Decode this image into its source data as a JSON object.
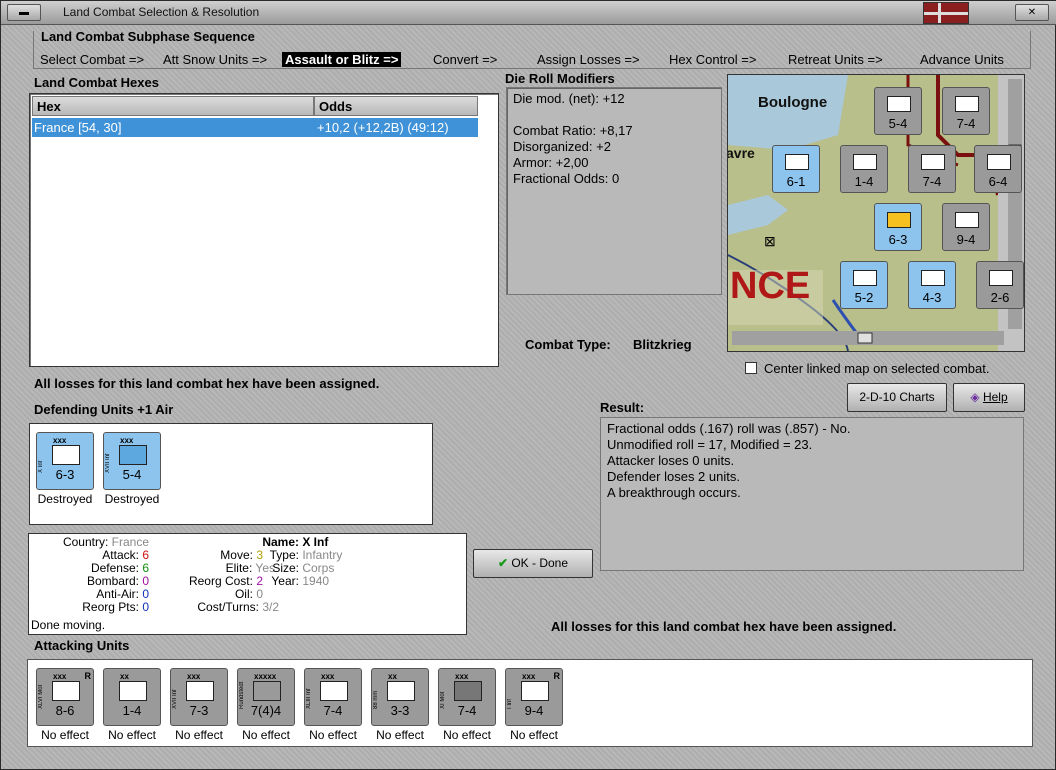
{
  "window": {
    "title": "Land Combat Selection & Resolution"
  },
  "phase": {
    "title": "Land Combat Subphase Sequence",
    "steps": [
      "Select Combat =>",
      "Att Snow Units =>",
      "Assault or Blitz =>",
      "Convert =>",
      "Assign Losses =>",
      "Hex Control =>",
      "Retreat Units =>",
      "Advance Units"
    ],
    "active_index": 2
  },
  "hexes": {
    "label": "Land Combat Hexes",
    "columns": [
      "Hex",
      "Odds"
    ],
    "rows": [
      {
        "hex": "France [54, 30]",
        "odds": "+10,2 (+12,2B) (49:12)"
      }
    ]
  },
  "drm": {
    "label": "Die Roll Modifiers",
    "lines": [
      "Die mod. (net): +12",
      "",
      "Combat Ratio: +8,17",
      "Disorganized: +2",
      "Armor: +2,00",
      "Fractional Odds: 0"
    ]
  },
  "combat_type": {
    "label": "Combat Type:",
    "value": "Blitzkrieg"
  },
  "center_map": {
    "label": "Center linked map on selected combat.",
    "checked": false
  },
  "buttons": {
    "charts": "2-D-10 Charts",
    "help": "Help",
    "ok": "OK - Done"
  },
  "losses_msg": "All losses for this land combat hex have been assigned.",
  "defenders": {
    "label": "Defending Units +1 Air",
    "units": [
      {
        "corps": "xxx",
        "name": "X Inf",
        "strength": "6-3",
        "status": "Destroyed"
      },
      {
        "corps": "xxx",
        "name": "XVII Inf",
        "strength": "5-4",
        "status": "Destroyed"
      }
    ]
  },
  "result": {
    "label": "Result:",
    "lines": [
      "Fractional odds (.167) roll was (.857)  - No.",
      "Unmodified roll = 17, Modified = 23.",
      "Attacker loses 0 units.",
      "Defender loses 2 units.",
      "A breakthrough occurs."
    ]
  },
  "info": {
    "country_k": "Country:",
    "country_v": "France",
    "attack_k": "Attack:",
    "attack_v": "6",
    "defense_k": "Defense:",
    "defense_v": "6",
    "bombard_k": "Bombard:",
    "bombard_v": "0",
    "antiair_k": "Anti-Air:",
    "antiair_v": "0",
    "reorgpts_k": "Reorg Pts:",
    "reorgpts_v": "0",
    "done": "Done moving.",
    "move_k": "Move:",
    "move_v": "3",
    "elite_k": "Elite:",
    "elite_v": "Yes",
    "reorgcost_k": "Reorg Cost:",
    "reorgcost_v": "2",
    "oil_k": "Oil:",
    "oil_v": "0",
    "costturns_k": "Cost/Turns:",
    "costturns_v": "3/2",
    "name_k": "Name:",
    "name_v": "X Inf",
    "type_k": "Type:",
    "type_v": "Infantry",
    "size_k": "Size:",
    "size_v": "Corps",
    "year_k": "Year:",
    "year_v": "1940"
  },
  "attackers": {
    "label": "Attacking Units",
    "units": [
      {
        "corps": "xxx",
        "name": "XLVI Mot",
        "strength": "8-6",
        "status": "No effect",
        "r": "R"
      },
      {
        "corps": "xx",
        "name": "",
        "strength": "1-4",
        "status": "No effect",
        "r": ""
      },
      {
        "corps": "xxx",
        "name": "XVII Inf",
        "strength": "7-3",
        "status": "No effect",
        "r": ""
      },
      {
        "corps": "xxxxx",
        "name": "Rundstedt",
        "strength": "7(4)4",
        "status": "No effect",
        "r": ""
      },
      {
        "corps": "xxx",
        "name": "XLIII Inf",
        "strength": "7-4",
        "status": "No effect",
        "r": ""
      },
      {
        "corps": "xx",
        "name": "88 mm",
        "strength": "3-3",
        "status": "No effect",
        "r": ""
      },
      {
        "corps": "xxx",
        "name": "XI Mot",
        "strength": "7-4",
        "status": "No effect",
        "r": ""
      },
      {
        "corps": "xxx",
        "name": "I Inf",
        "strength": "9-4",
        "status": "No effect",
        "r": "R"
      }
    ]
  },
  "map": {
    "labels": [
      "Boulogne",
      "avre",
      "NCE"
    ],
    "counters": [
      {
        "strength": "5-4",
        "name": "Alpine"
      },
      {
        "strength": "7-4",
        "name": "XXII Inf"
      },
      {
        "strength": "6-1",
        "name": "VI Corp"
      },
      {
        "strength": "1-4",
        "name": ""
      },
      {
        "strength": "7-4",
        "name": "XVIII Inf"
      },
      {
        "strength": "6-4",
        "name": "XIV Inf"
      },
      {
        "strength": "6-3",
        "name": "X Inf"
      },
      {
        "strength": "9-4",
        "name": "I Inf"
      },
      {
        "strength": "5-2",
        "name": "Paris"
      },
      {
        "strength": "4-3",
        "name": "XVII Inf"
      },
      {
        "strength": "2-6",
        "name": "II Arm"
      }
    ]
  }
}
